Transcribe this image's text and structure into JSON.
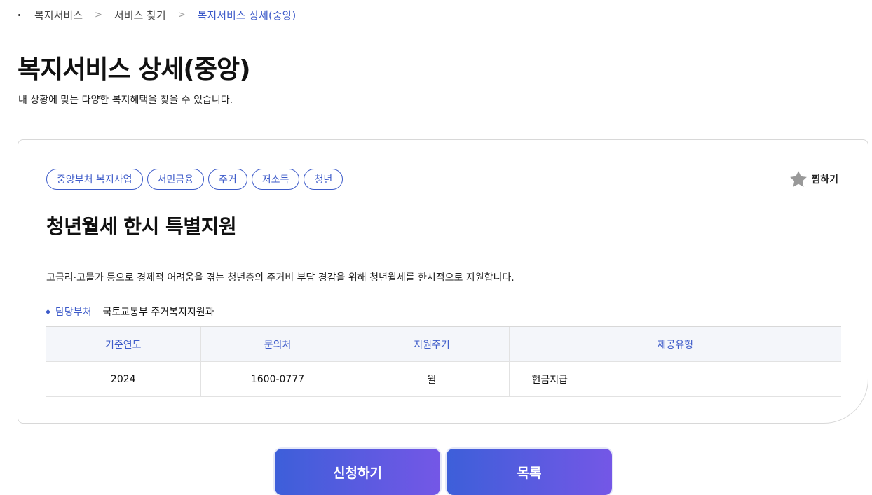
{
  "breadcrumb": {
    "items": [
      "복지서비스",
      "서비스 찾기",
      "복지서비스 상세(중앙)"
    ]
  },
  "page": {
    "title": "복지서비스 상세(중앙)",
    "description": "내 상황에 맞는 다양한 복지혜택을 찾을 수 있습니다."
  },
  "service": {
    "tags": [
      "중앙부처 복지사업",
      "서민금융",
      "주거",
      "저소득",
      "청년"
    ],
    "favorite_label": "찜하기",
    "title": "청년월세 한시 특별지원",
    "description": "고금리·고물가 등으로 경제적 어려움을 겪는 청년층의 주거비 부담 경감을 위해 청년월세를 한시적으로 지원합니다.",
    "dept_label": "담당부처",
    "dept_value": "국토교통부 주거복지지원과",
    "table": {
      "headers": [
        "기준연도",
        "문의처",
        "지원주기",
        "제공유형"
      ],
      "row": [
        "2024",
        "1600-0777",
        "월",
        "현금지급"
      ]
    }
  },
  "actions": {
    "apply_label": "신청하기",
    "list_label": "목록"
  },
  "colors": {
    "accent": "#3d5bc9",
    "button_gradient_start": "#3d5fd9",
    "button_gradient_end": "#7457e6",
    "star": "#999999"
  },
  "icons": {
    "favorite": "star-icon",
    "breadcrumb_separator": "chevron-right-icon"
  }
}
